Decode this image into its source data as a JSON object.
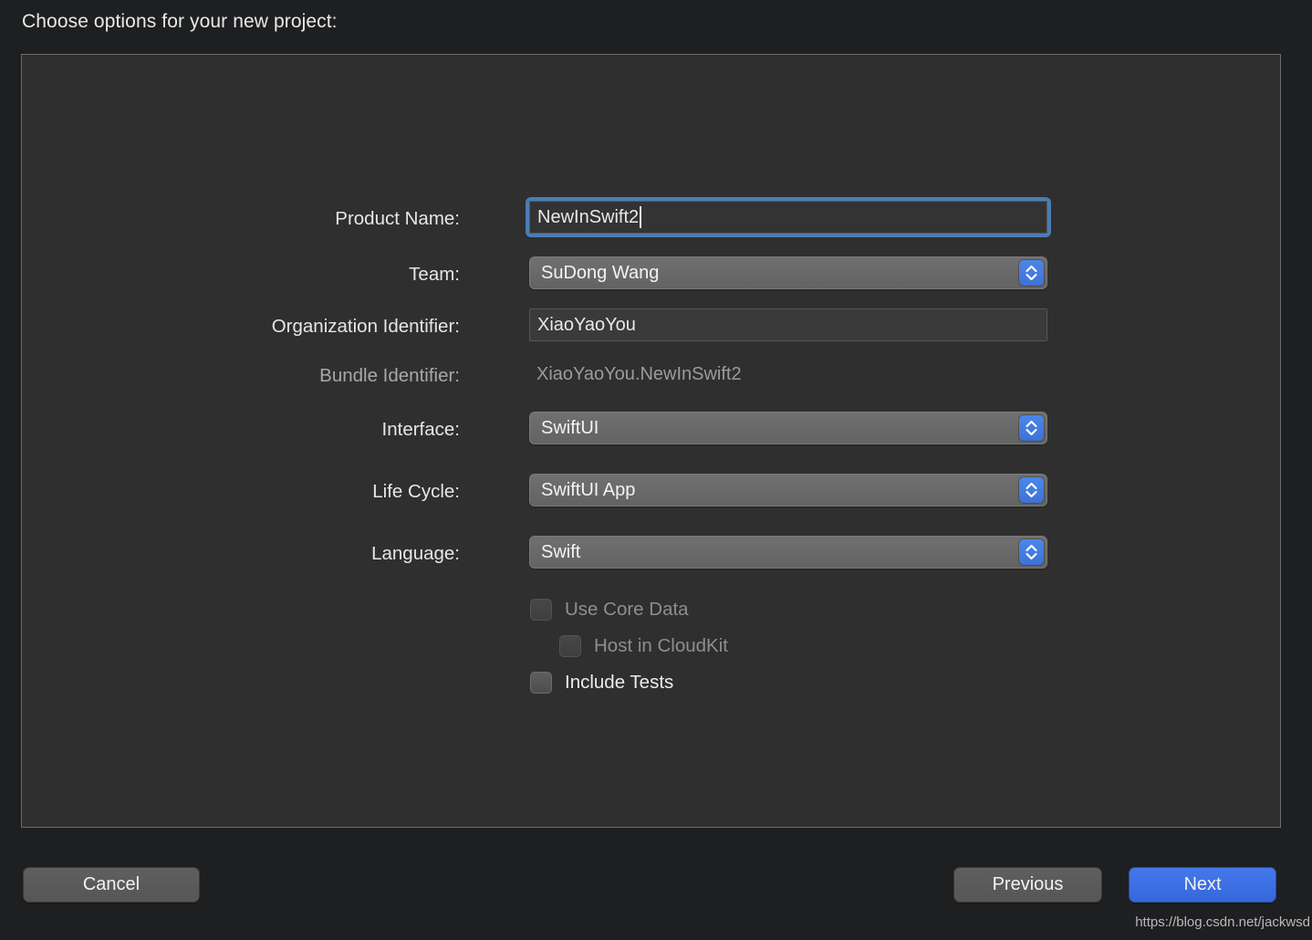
{
  "prompt": {
    "title": "Choose options for your new project:"
  },
  "form": {
    "rows": [
      {
        "label": "Product Name:",
        "type": "text-focused",
        "value": "NewInSwift2",
        "placeholder": "",
        "disabled": false
      },
      {
        "label": "Team:",
        "type": "popup",
        "value": "SuDong Wang",
        "disabled": false
      },
      {
        "label": "Organization Identifier:",
        "type": "text",
        "value": "XiaoYaoYou",
        "placeholder": "",
        "disabled": false
      },
      {
        "label": "Bundle Identifier:",
        "type": "static",
        "value": "XiaoYaoYou.NewInSwift2",
        "disabled": true
      },
      {
        "label": "Interface:",
        "type": "popup",
        "value": "SwiftUI",
        "disabled": false
      },
      {
        "label": "Life Cycle:",
        "type": "popup",
        "value": "SwiftUI App",
        "disabled": false
      },
      {
        "label": "Language:",
        "type": "popup",
        "value": "Swift",
        "disabled": false
      }
    ],
    "checkboxes": [
      {
        "label": "Use Core Data",
        "checked": false,
        "disabled": true
      },
      {
        "label": "Host in CloudKit",
        "checked": false,
        "disabled": true
      },
      {
        "label": "Include Tests",
        "checked": false,
        "disabled": false
      }
    ]
  },
  "buttons": {
    "cancel": "Cancel",
    "previous": "Previous",
    "next": "Next"
  },
  "watermark": {
    "text": "https://blog.csdn.net/jackwsd"
  },
  "colors": {
    "window_background": "#1e1f21",
    "panel_background": "#2f2f2f",
    "panel_border": "#6b6b6b",
    "focus_ring": "#4a7db3",
    "accent_blue": "#3d72d6",
    "primary_button": "#3f72e3",
    "text_primary": "#e9e9e9",
    "text_disabled": "#9b9b9b"
  }
}
